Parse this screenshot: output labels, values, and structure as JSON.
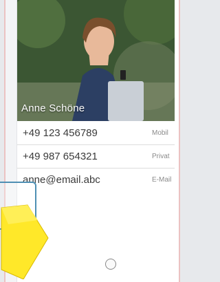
{
  "contact": {
    "name": "Anne Schöne",
    "entries": [
      {
        "value": "+49 123 456789",
        "type": "Mobil"
      },
      {
        "value": "+49 987 654321",
        "type": "Privat"
      },
      {
        "value": "anne@email.abc",
        "type": "E-Mail"
      }
    ]
  },
  "icons": {
    "home": "home-button-circle"
  }
}
